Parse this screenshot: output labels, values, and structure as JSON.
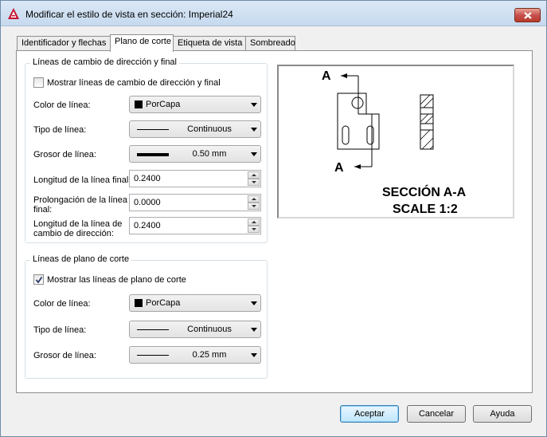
{
  "window": {
    "title": "Modificar el estilo de vista en sección: Imperial24"
  },
  "tabs": [
    {
      "label": "Identificador y flechas",
      "active": false
    },
    {
      "label": "Plano de corte",
      "active": true
    },
    {
      "label": "Etiqueta de vista",
      "active": false
    },
    {
      "label": "Sombreado",
      "active": false
    }
  ],
  "group1": {
    "legend": "Líneas de cambio de dirección y final",
    "show_checkbox": {
      "label": "Mostrar líneas de cambio de dirección y final",
      "checked": false
    },
    "line_color": {
      "label": "Color de línea:",
      "value": "PorCapa"
    },
    "line_type": {
      "label": "Tipo de línea:",
      "value": "Continuous"
    },
    "line_weight": {
      "label": "Grosor de línea:",
      "value": "0.50 mm"
    },
    "end_line_length": {
      "label": "Longitud de la línea final:",
      "value": "0.2400"
    },
    "end_line_overshoot": {
      "label_1": "Prolongación de la línea",
      "label_2": "final:",
      "value": "0.0000"
    },
    "bend_line_length": {
      "label_1": "Longitud de la línea de",
      "label_2": "cambio de dirección:",
      "value": "0.2400"
    }
  },
  "group2": {
    "legend": "Líneas de plano de corte",
    "show_checkbox": {
      "label": "Mostrar las líneas de plano de corte",
      "checked": true
    },
    "line_color": {
      "label": "Color de línea:",
      "value": "PorCapa"
    },
    "line_type": {
      "label": "Tipo de línea:",
      "value": "Continuous"
    },
    "line_weight": {
      "label": "Grosor de línea:",
      "value": "0.25 mm"
    }
  },
  "preview": {
    "label_top": "A",
    "label_bottom": "A",
    "section_title": "SECCIÓN A-A",
    "scale_text": "SCALE 1:2"
  },
  "buttons": {
    "ok": "Aceptar",
    "cancel": "Cancelar",
    "help": "Ayuda"
  },
  "colors": {
    "logo_red": "#c8102e",
    "close_red": "#c75050",
    "default_button_border": "#3c7fb1"
  }
}
